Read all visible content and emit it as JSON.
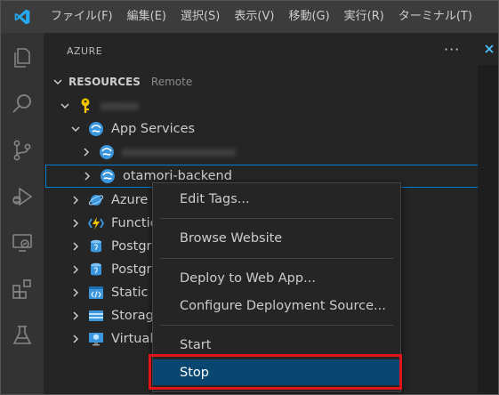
{
  "menubar": {
    "items": [
      "ファイル(F)",
      "編集(E)",
      "選択(S)",
      "表示(V)",
      "移動(G)",
      "実行(R)",
      "ターミナル(T)"
    ]
  },
  "activitybar": {
    "icons": [
      "explorer-icon",
      "search-icon",
      "source-control-icon",
      "run-debug-icon",
      "remote-explorer-icon",
      "extensions-icon",
      "testing-icon"
    ]
  },
  "sidebar": {
    "title": "AZURE",
    "more": "···",
    "section_title": "RESOURCES",
    "section_sub": "Remote",
    "subscription_name": "xxxxxx",
    "tree": [
      {
        "label": "App Services",
        "icon": "app-service-icon"
      },
      {
        "label": "xxxxxxxxxxxxxxxxxx",
        "icon": "app-service-icon",
        "blurred": true
      },
      {
        "label": "otamori-backend",
        "icon": "app-service-icon",
        "selected": true
      },
      {
        "label": "Azure",
        "icon": "azure-cosmos-icon"
      },
      {
        "label": "Functio",
        "icon": "function-app-icon"
      },
      {
        "label": "Postgr",
        "icon": "postgres-icon"
      },
      {
        "label": "Postgr",
        "icon": "postgres-icon"
      },
      {
        "label": "Static W",
        "icon": "static-web-app-icon"
      },
      {
        "label": "Storag",
        "icon": "storage-icon"
      },
      {
        "label": "Virtual",
        "icon": "virtual-machine-icon"
      }
    ]
  },
  "context_menu": {
    "groups": [
      [
        "Edit Tags..."
      ],
      [
        "Browse Website"
      ],
      [
        "Deploy to Web App...",
        "Configure Deployment Source..."
      ],
      [
        "Start",
        "Stop"
      ]
    ],
    "active": "Stop"
  },
  "colors": {
    "accent": "#007acc",
    "highlight": "#e1141c",
    "menu_active": "#094771"
  }
}
